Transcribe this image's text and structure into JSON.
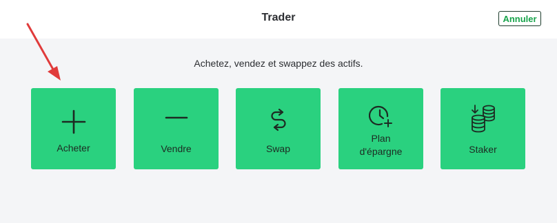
{
  "header": {
    "title": "Trader",
    "cancel_label": "Annuler"
  },
  "subtitle": "Achetez, vendez et swappez des actifs.",
  "actions": [
    {
      "label": "Acheter",
      "icon": "plus-icon"
    },
    {
      "label": "Vendre",
      "icon": "minus-icon"
    },
    {
      "label": "Swap",
      "icon": "swap-icon"
    },
    {
      "label": "Plan\nd'épargne",
      "label_line1": "Plan",
      "label_line2": "d'épargne",
      "icon": "clock-plus-icon"
    },
    {
      "label": "Staker",
      "icon": "coins-stack-icon"
    }
  ],
  "colors": {
    "tile": "#2ad17f",
    "cancel_text": "#16a34a",
    "annotation_arrow": "#e03b3b"
  }
}
